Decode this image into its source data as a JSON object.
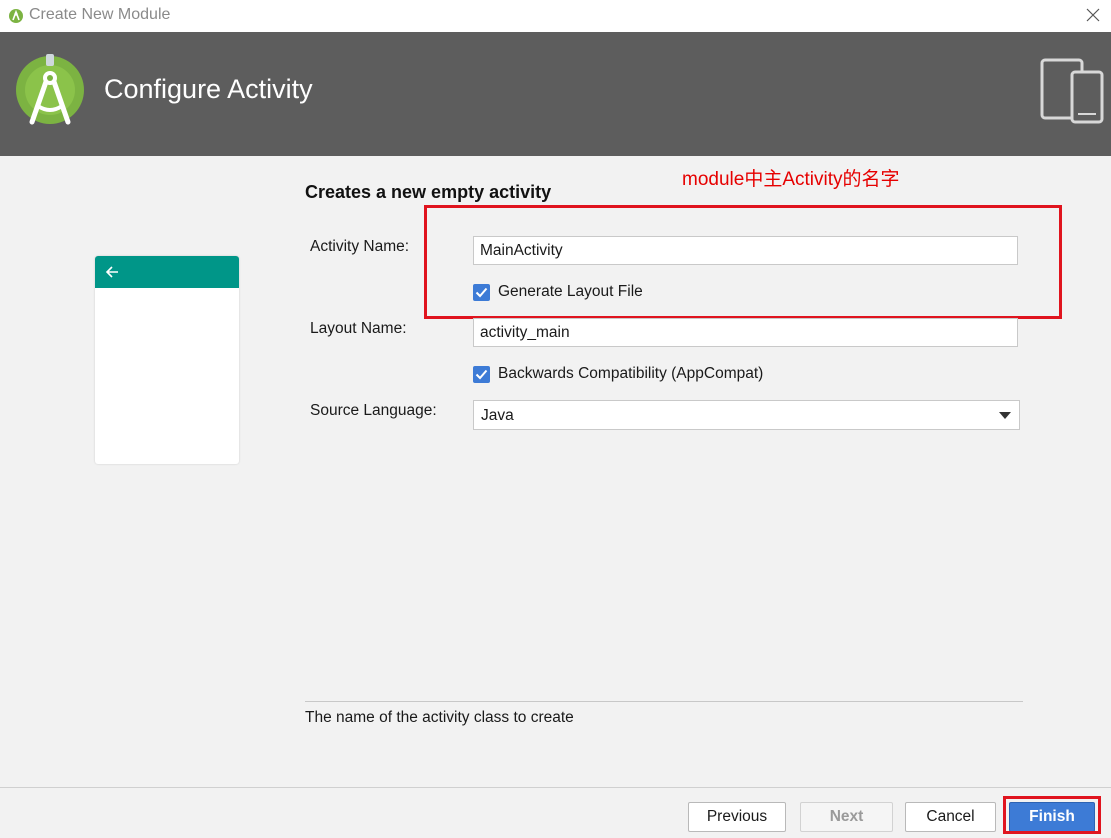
{
  "window": {
    "title": "Create New Module",
    "close_icon": "close-icon"
  },
  "header": {
    "title": "Configure Activity",
    "logo_icon": "android-studio-logo",
    "device_icon": "devices-icon"
  },
  "annotation": {
    "text": "module中主Activity的名字",
    "color": "#e60000"
  },
  "form": {
    "section_title": "Creates a new empty activity",
    "activity_name": {
      "label": "Activity Name:",
      "value": "MainActivity"
    },
    "generate_layout": {
      "label": "Generate Layout File",
      "checked": true
    },
    "layout_name": {
      "label": "Layout Name:",
      "value": "activity_main"
    },
    "backwards_compat": {
      "label": "Backwards Compatibility (AppCompat)",
      "checked": true
    },
    "source_language": {
      "label": "Source Language:",
      "value": "Java"
    }
  },
  "preview": {
    "appbar_color": "#009688",
    "back_icon": "arrow-left-icon"
  },
  "help": {
    "text": "The name of the activity class to create"
  },
  "buttons": {
    "previous": "Previous",
    "next": "Next",
    "cancel": "Cancel",
    "finish": "Finish"
  },
  "colors": {
    "header_bg": "#5d5d5d",
    "primary": "#3d7bd6",
    "highlight": "#e0141e"
  }
}
